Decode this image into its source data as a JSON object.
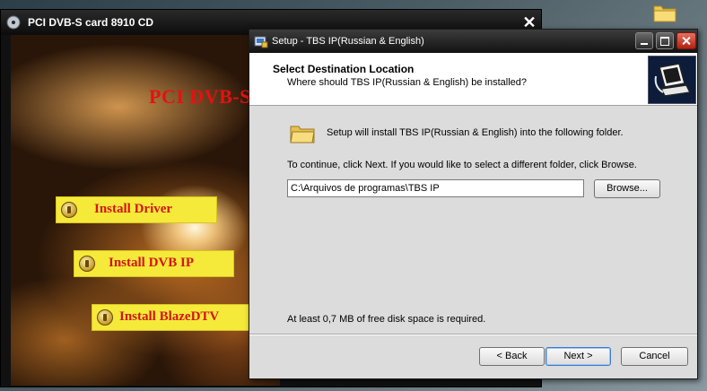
{
  "launcher": {
    "title": "PCI DVB-S card 8910 CD",
    "brand": "PCI DVB-S",
    "buttons": [
      {
        "label": "Install Driver"
      },
      {
        "label": "Install DVB IP"
      },
      {
        "label": "Install BlazeDTV"
      }
    ]
  },
  "setup": {
    "title": "Setup - TBS IP(Russian & English)",
    "header_title": "Select Destination Location",
    "header_subtitle": "Where should TBS IP(Russian & English) be installed?",
    "install_text": "Setup will install TBS IP(Russian & English) into the following folder.",
    "continue_text": "To continue, click Next. If you would like to select a different folder, click Browse.",
    "path_value": "C:\\Arquivos de programas\\TBS IP",
    "browse_label": "Browse...",
    "space_text": "At least 0,7 MB of free disk space is required.",
    "back_label": "< Back",
    "next_label": "Next >",
    "cancel_label": "Cancel"
  },
  "icons": {
    "desktop": "folder-icon",
    "launcher_app": "disc-icon",
    "setup_app": "installer-icon",
    "header_logo": "computer-install-icon"
  },
  "colors": {
    "launcher_button_bg": "#f5e93a",
    "launcher_button_text": "#d41515",
    "brand_text": "#e81010"
  }
}
